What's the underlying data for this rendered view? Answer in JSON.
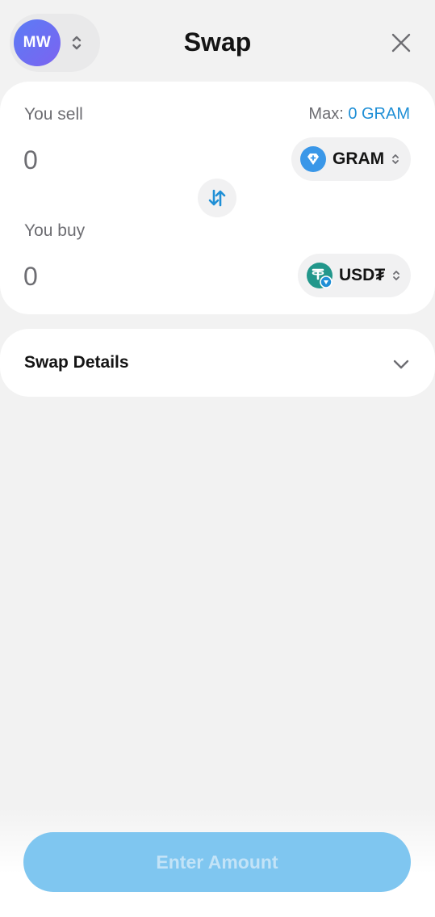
{
  "header": {
    "avatar_initials": "MW",
    "title": "Swap"
  },
  "sell": {
    "label": "You sell",
    "max_prefix": "Max: ",
    "max_value": "0 GRAM",
    "amount": "0",
    "token": "GRAM"
  },
  "buy": {
    "label": "You buy",
    "amount": "0",
    "token": "USD₮"
  },
  "details": {
    "title": "Swap Details"
  },
  "action": {
    "button_label": "Enter Amount"
  },
  "colors": {
    "background": "#f2f2f2",
    "card": "#ffffff",
    "accent": "#1f8fd6",
    "button_disabled": "#7fc6f0",
    "avatar": "#6a70f2",
    "gram_icon": "#3a97e8",
    "usdt_icon": "#22978b"
  },
  "icons": {
    "account_switch": "up-down-chevron-icon",
    "close": "close-icon",
    "gram": "gram-diamond-icon",
    "usdt": "tether-icon",
    "swap_direction": "swap-arrows-icon",
    "details_toggle": "chevron-down-icon"
  }
}
